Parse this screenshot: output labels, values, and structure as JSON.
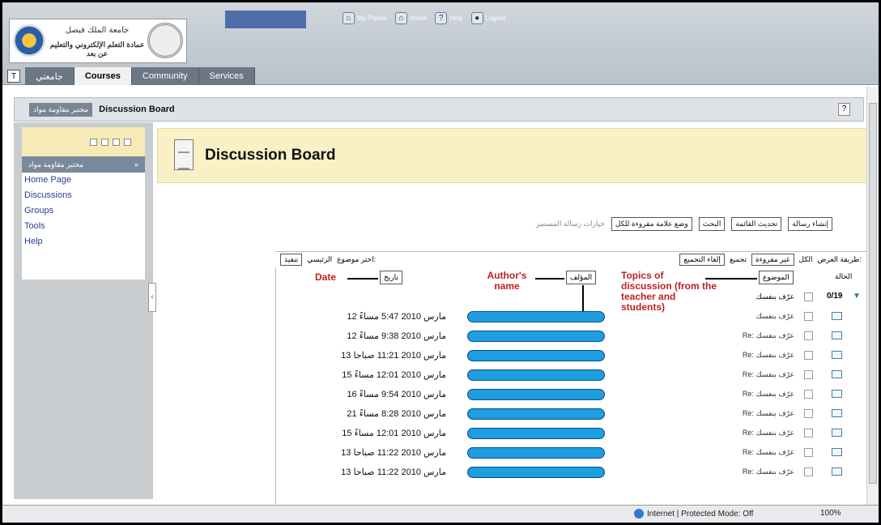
{
  "header": {
    "logo_line1": "عمادة التعلم الإلكتروني والتعليم عن بعد",
    "logo_line0": "جامعة الملك فيصل",
    "top_links": [
      {
        "label": "My Places",
        "icon": "places-icon"
      },
      {
        "label": "Home",
        "icon": "home-icon"
      },
      {
        "label": "Help",
        "icon": "help-icon"
      },
      {
        "label": "Logout",
        "icon": "logout-icon"
      }
    ],
    "tabs": [
      "جامعتي",
      "Courses",
      "Community",
      "Services"
    ]
  },
  "breadcrumb": {
    "course": "مختبر مقاومة مواد",
    "page": "Discussion Board",
    "help": "?"
  },
  "sidebar": {
    "title": "مختبر مقاومة مواد",
    "items": [
      "Home Page",
      "Discussions",
      "Groups",
      "Tools",
      "Help"
    ]
  },
  "main": {
    "title": "Discussion Board",
    "actions": [
      "إنشاء رسالة",
      "تحديث القائمة",
      "البحث",
      "وضع علامة مقروءة للكل"
    ],
    "actions_disabled": "خيارات رسالة المستمر",
    "toolrow": {
      "view_label": "طريقة العرض:",
      "all": "الكل",
      "unread": "غير مقروءة",
      "group": "تجميع",
      "ungroup": "إلغاء التجميع",
      "pick_topic": "اختر موضوع:",
      "main_topic": "الرئيسي",
      "execute": "تنفيذ"
    },
    "headers": {
      "status": "الحالة",
      "topic": "الموضوع",
      "author": "المؤلف",
      "date": "تاريخ"
    },
    "annotations": {
      "date": "Date",
      "author": "Author's name",
      "topic": "Topics of discussion (from the teacher and students)"
    },
    "thread": {
      "count": "0/19",
      "title": "عرّف بنفسك"
    },
    "rows": [
      {
        "topic": "عرّف بنفسك",
        "date": "12 مارس 2010 5:47 مساءً"
      },
      {
        "topic": "Re: عرّف بنفسك",
        "date": "12 مارس 2010 9:38 مساءً"
      },
      {
        "topic": "Re: عرّف بنفسك",
        "date": "13 مارس 2010 11:21 صباحا"
      },
      {
        "topic": "Re: عرّف بنفسك",
        "date": "15 مارس 2010 12:01 مساءً"
      },
      {
        "topic": "Re: عرّف بنفسك",
        "date": "16 مارس 2010 9:54 مساءً"
      },
      {
        "topic": "Re: عرّف بنفسك",
        "date": "21 مارس 2010 8:28 مساءً"
      },
      {
        "topic": "Re: عرّف بنفسك",
        "date": "15 مارس 2010 12:01 مساءً"
      },
      {
        "topic": "Re: عرّف بنفسك",
        "date": "13 مارس 2010 11:22 صباحا"
      },
      {
        "topic": "Re: عرّف بنفسك",
        "date": "13 مارس 2010 11:22 صباحا"
      }
    ]
  },
  "statusbar": {
    "zone": "Internet | Protected Mode: Off",
    "zoom": "100%"
  },
  "colors": {
    "author_redaction": "#1e9de0",
    "annotation": "#c02020",
    "title_band": "#faf0c6"
  }
}
